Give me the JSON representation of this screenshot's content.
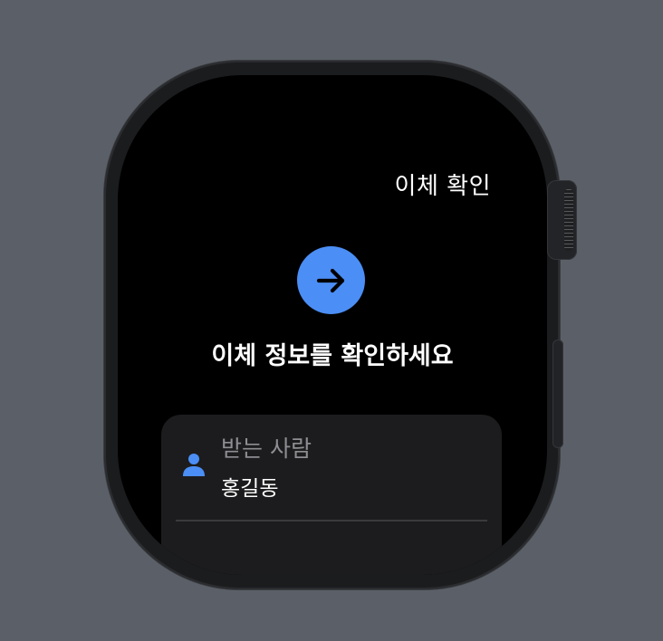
{
  "screen": {
    "title": "이체 확인",
    "heading": "이체 정보를 확인하세요"
  },
  "recipient": {
    "label": "받는 사람",
    "name": "홍길동"
  },
  "colors": {
    "accent": "#4b8ef5",
    "background": "#000000",
    "card": "#1c1c1e",
    "secondary_text": "#8e8e93"
  },
  "icons": {
    "status": "arrow-right-icon",
    "recipient": "person-icon"
  }
}
